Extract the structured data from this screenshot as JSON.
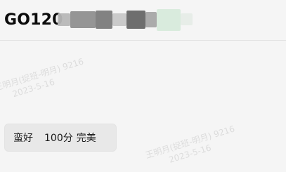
{
  "header": {
    "title": "GO120"
  },
  "redaction": {
    "colors": [
      "#8f8f8f",
      "#7b7b7b",
      "#666666",
      "#b7b7b7",
      "#d7eadb",
      "#c7c7c7"
    ]
  },
  "watermarks": [
    {
      "name": "王明月(捉班-明月) 9216",
      "date": "2023-5-16"
    },
    {
      "name": "王明月(捉班-明月) 9216",
      "date": "2023-5-16"
    }
  ],
  "review": {
    "rating_label": "蛮好",
    "score": "100分",
    "summary": "完美"
  }
}
